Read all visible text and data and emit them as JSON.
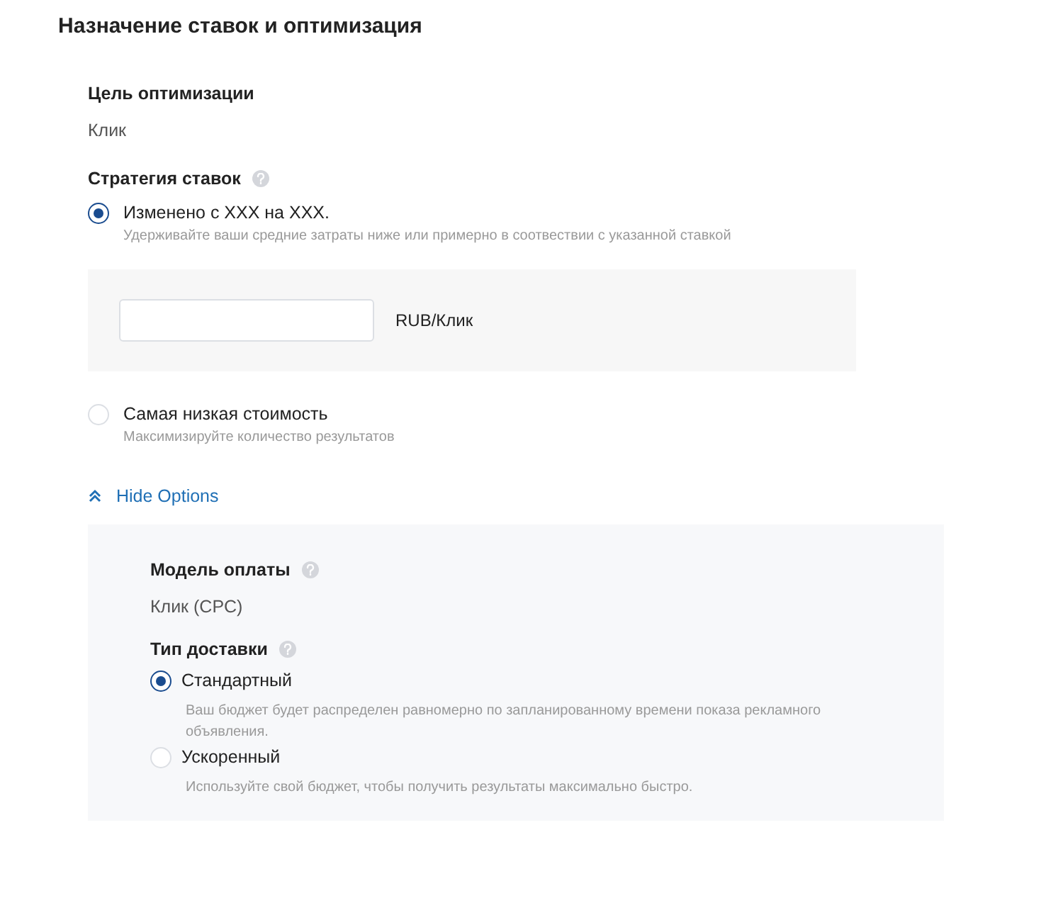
{
  "title": "Назначение ставок и оптимизация",
  "optimization_goal": {
    "label": "Цель оптимизации",
    "value": "Клик"
  },
  "bid_strategy": {
    "label": "Стратегия ставок",
    "has_help": true,
    "options": [
      {
        "label": "Изменено с XXX на XXX.",
        "description": "Удерживайте ваши средние затраты ниже или примерно в соотвествии с указанной ставкой",
        "selected": true,
        "bid": {
          "unit": "RUB/Клик"
        }
      },
      {
        "label": "Самая низкая стоимость",
        "description": "Максимизируйте количество результатов",
        "selected": false
      }
    ]
  },
  "options_toggle": {
    "label": "Hide Options",
    "expanded": true
  },
  "payment_model": {
    "label": "Модель оплаты",
    "has_help": true,
    "value": "Клик (CPC)"
  },
  "delivery_type": {
    "label": "Тип доставки",
    "has_help": true,
    "options": [
      {
        "label": "Стандартный",
        "description": "Ваш бюджет будет распределен равномерно по запланированному времени показа рекламного объявления.",
        "selected": true
      },
      {
        "label": "Ускоренный",
        "description": "Используйте свой бюджет, чтобы получить результаты максимально быстро.",
        "selected": false
      }
    ]
  }
}
